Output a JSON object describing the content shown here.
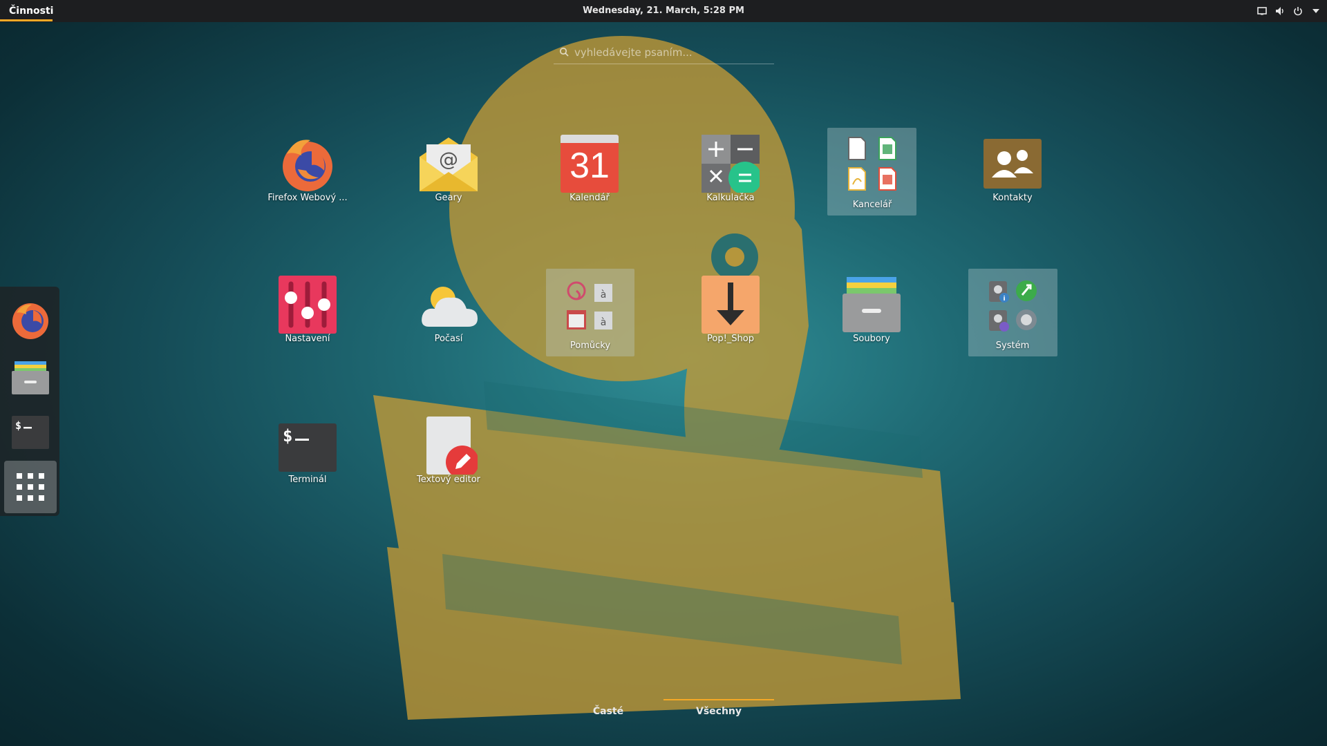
{
  "topbar": {
    "activities_label": "Činnosti",
    "clock": "Wednesday, 21. March,  5:28 PM",
    "tray_icons": [
      "screen-icon",
      "volume-icon",
      "power-icon",
      "chevron-down-icon"
    ]
  },
  "search": {
    "placeholder": "vyhledávejte psaním..."
  },
  "dash": {
    "items": [
      {
        "name": "firefox",
        "icon": "firefox-icon"
      },
      {
        "name": "files",
        "icon": "files-icon"
      },
      {
        "name": "terminal",
        "icon": "terminal-icon"
      },
      {
        "name": "show-applications",
        "icon": "app-grid-icon"
      }
    ]
  },
  "apps": {
    "firefox": "Firefox Webový ...",
    "geary": "Geary",
    "calendar": "Kalendář",
    "calendar_day": "31",
    "calculator": "Kalkulačka",
    "office": "Kancelář",
    "contacts": "Kontakty",
    "settings": "Nastavení",
    "weather": "Počasí",
    "utilities": "Pomůcky",
    "popshop": "Pop!_Shop",
    "files": "Soubory",
    "system": "Systém",
    "terminal": "Terminál",
    "text_editor": "Textový editor"
  },
  "tabs": {
    "frequent": "Časté",
    "all": "Všechny"
  },
  "colors": {
    "accent": "#f6a826",
    "topbar": "#1d1e20"
  }
}
